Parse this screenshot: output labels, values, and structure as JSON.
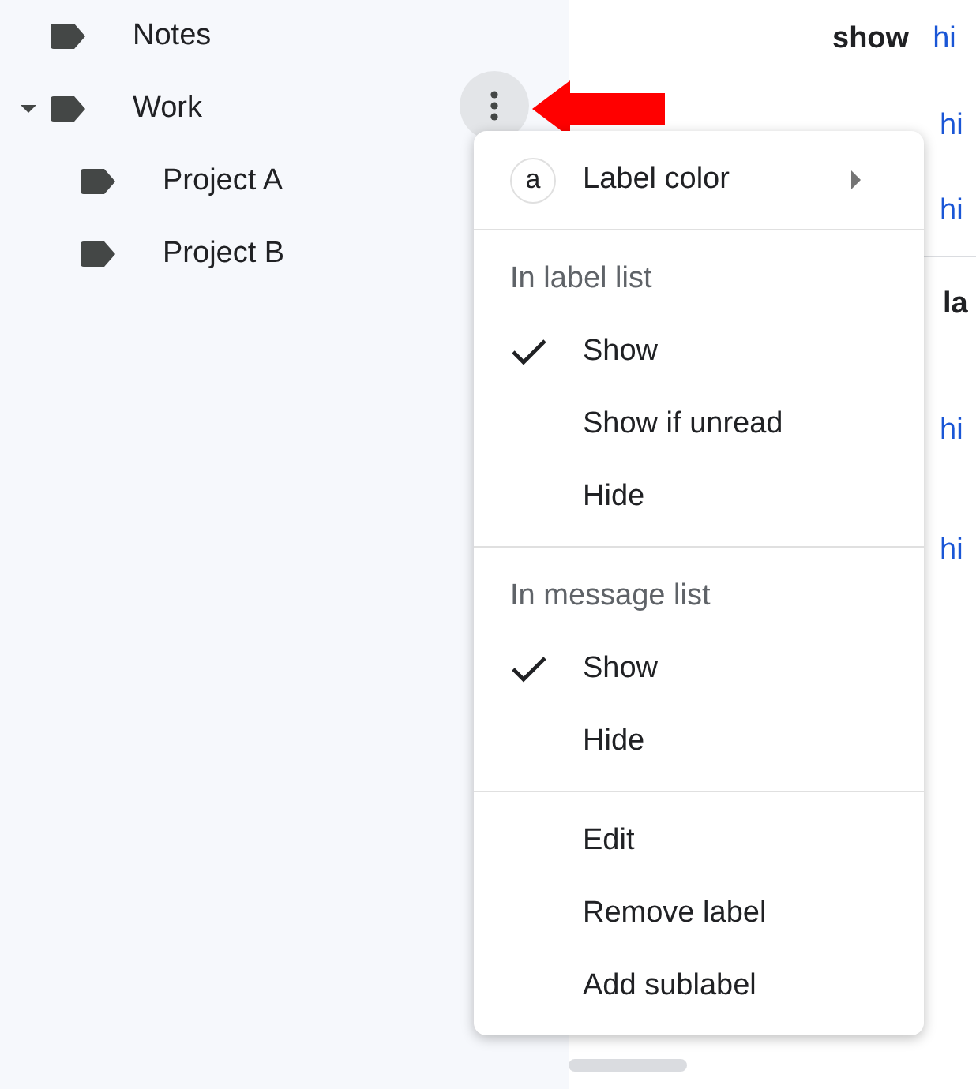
{
  "sidebar": {
    "labels": [
      {
        "name": "Notes"
      },
      {
        "name": "Work",
        "expanded": true,
        "children": [
          {
            "name": "Project A"
          },
          {
            "name": "Project B"
          }
        ]
      }
    ]
  },
  "background_rows": [
    {
      "kind": "pair",
      "action": "show",
      "link": "hi"
    },
    {
      "kind": "link",
      "link": "hi"
    },
    {
      "kind": "link",
      "link": "hi"
    },
    {
      "kind": "heading",
      "text": "la"
    },
    {
      "kind": "link",
      "link": "hi"
    },
    {
      "kind": "link",
      "link": "hi"
    }
  ],
  "menu": {
    "sections": [
      {
        "items": [
          {
            "kind": "submenu",
            "badge": "a",
            "label": "Label color"
          }
        ]
      },
      {
        "heading": "In label list",
        "items": [
          {
            "kind": "option",
            "label": "Show",
            "checked": true
          },
          {
            "kind": "option",
            "label": "Show if unread",
            "checked": false
          },
          {
            "kind": "option",
            "label": "Hide",
            "checked": false
          }
        ]
      },
      {
        "heading": "In message list",
        "items": [
          {
            "kind": "option",
            "label": "Show",
            "checked": true
          },
          {
            "kind": "option",
            "label": "Hide",
            "checked": false
          }
        ]
      },
      {
        "items": [
          {
            "kind": "action",
            "label": "Edit"
          },
          {
            "kind": "action",
            "label": "Remove label"
          },
          {
            "kind": "action",
            "label": "Add sublabel"
          }
        ]
      }
    ]
  }
}
